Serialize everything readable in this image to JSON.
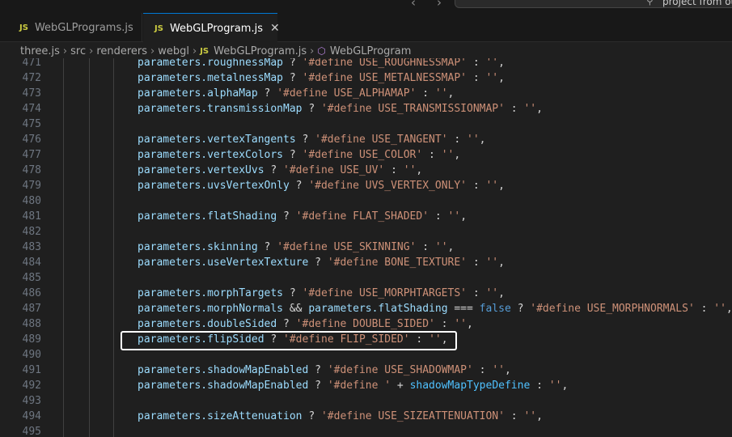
{
  "topbar": {
    "back_icon": "chevron-left-icon",
    "forward_icon": "chevron-right-icon",
    "command_center_text": "project from ouse"
  },
  "tabs": [
    {
      "badge": "JS",
      "label": "WebGLPrograms.js",
      "active": false
    },
    {
      "badge": "JS",
      "label": "WebGLProgram.js",
      "active": true
    }
  ],
  "breadcrumb": {
    "items": [
      "three.js",
      "src",
      "renderers",
      "webgl"
    ],
    "file_badge": "JS",
    "file": "WebGLProgram.js",
    "symbol": "WebGLProgram"
  },
  "colors": {
    "accent": "#0078d4",
    "property": "#9cdcfe",
    "string": "#ce9178",
    "keyword": "#569cd6",
    "variable": "#4fc1ff"
  },
  "code_lines": [
    {
      "num": "471",
      "tokens": [
        [
          "obj",
          "parameters.roughnessMap"
        ],
        [
          "op",
          " ? "
        ],
        [
          "str",
          "'#define USE_ROUGHNESSMAP'"
        ],
        [
          "op",
          " : "
        ],
        [
          "str",
          "''"
        ],
        [
          "op",
          ","
        ]
      ]
    },
    {
      "num": "472",
      "tokens": [
        [
          "obj",
          "parameters.metalnessMap"
        ],
        [
          "op",
          " ? "
        ],
        [
          "str",
          "'#define USE_METALNESSMAP'"
        ],
        [
          "op",
          " : "
        ],
        [
          "str",
          "''"
        ],
        [
          "op",
          ","
        ]
      ]
    },
    {
      "num": "473",
      "tokens": [
        [
          "obj",
          "parameters.alphaMap"
        ],
        [
          "op",
          " ? "
        ],
        [
          "str",
          "'#define USE_ALPHAMAP'"
        ],
        [
          "op",
          " : "
        ],
        [
          "str",
          "''"
        ],
        [
          "op",
          ","
        ]
      ]
    },
    {
      "num": "474",
      "tokens": [
        [
          "obj",
          "parameters.transmissionMap"
        ],
        [
          "op",
          " ? "
        ],
        [
          "str",
          "'#define USE_TRANSMISSIONMAP'"
        ],
        [
          "op",
          " : "
        ],
        [
          "str",
          "''"
        ],
        [
          "op",
          ","
        ]
      ]
    },
    {
      "num": "475",
      "tokens": []
    },
    {
      "num": "476",
      "tokens": [
        [
          "obj",
          "parameters.vertexTangents"
        ],
        [
          "op",
          " ? "
        ],
        [
          "str",
          "'#define USE_TANGENT'"
        ],
        [
          "op",
          " : "
        ],
        [
          "str",
          "''"
        ],
        [
          "op",
          ","
        ]
      ]
    },
    {
      "num": "477",
      "tokens": [
        [
          "obj",
          "parameters.vertexColors"
        ],
        [
          "op",
          " ? "
        ],
        [
          "str",
          "'#define USE_COLOR'"
        ],
        [
          "op",
          " : "
        ],
        [
          "str",
          "''"
        ],
        [
          "op",
          ","
        ]
      ]
    },
    {
      "num": "478",
      "tokens": [
        [
          "obj",
          "parameters.vertexUvs"
        ],
        [
          "op",
          " ? "
        ],
        [
          "str",
          "'#define USE_UV'"
        ],
        [
          "op",
          " : "
        ],
        [
          "str",
          "''"
        ],
        [
          "op",
          ","
        ]
      ]
    },
    {
      "num": "479",
      "tokens": [
        [
          "obj",
          "parameters.uvsVertexOnly"
        ],
        [
          "op",
          " ? "
        ],
        [
          "str",
          "'#define UVS_VERTEX_ONLY'"
        ],
        [
          "op",
          " : "
        ],
        [
          "str",
          "''"
        ],
        [
          "op",
          ","
        ]
      ]
    },
    {
      "num": "480",
      "tokens": []
    },
    {
      "num": "481",
      "tokens": [
        [
          "obj",
          "parameters.flatShading"
        ],
        [
          "op",
          " ? "
        ],
        [
          "str",
          "'#define FLAT_SHADED'"
        ],
        [
          "op",
          " : "
        ],
        [
          "str",
          "''"
        ],
        [
          "op",
          ","
        ]
      ]
    },
    {
      "num": "482",
      "tokens": []
    },
    {
      "num": "483",
      "tokens": [
        [
          "obj",
          "parameters.skinning"
        ],
        [
          "op",
          " ? "
        ],
        [
          "str",
          "'#define USE_SKINNING'"
        ],
        [
          "op",
          " : "
        ],
        [
          "str",
          "''"
        ],
        [
          "op",
          ","
        ]
      ]
    },
    {
      "num": "484",
      "tokens": [
        [
          "obj",
          "parameters.useVertexTexture"
        ],
        [
          "op",
          " ? "
        ],
        [
          "str",
          "'#define BONE_TEXTURE'"
        ],
        [
          "op",
          " : "
        ],
        [
          "str",
          "''"
        ],
        [
          "op",
          ","
        ]
      ]
    },
    {
      "num": "485",
      "tokens": []
    },
    {
      "num": "486",
      "tokens": [
        [
          "obj",
          "parameters.morphTargets"
        ],
        [
          "op",
          " ? "
        ],
        [
          "str",
          "'#define USE_MORPHTARGETS'"
        ],
        [
          "op",
          " : "
        ],
        [
          "str",
          "''"
        ],
        [
          "op",
          ","
        ]
      ]
    },
    {
      "num": "487",
      "tokens": [
        [
          "obj",
          "parameters.morphNormals"
        ],
        [
          "op",
          " && "
        ],
        [
          "obj",
          "parameters.flatShading"
        ],
        [
          "op",
          " === "
        ],
        [
          "kw",
          "false"
        ],
        [
          "op",
          " ? "
        ],
        [
          "str",
          "'#define USE_MORPHNORMALS'"
        ],
        [
          "op",
          " : "
        ],
        [
          "str",
          "''"
        ],
        [
          "op",
          ","
        ]
      ]
    },
    {
      "num": "488",
      "tokens": [
        [
          "obj",
          "parameters.doubleSided"
        ],
        [
          "op",
          " ? "
        ],
        [
          "str",
          "'#define DOUBLE_SIDED'"
        ],
        [
          "op",
          " : "
        ],
        [
          "str",
          "''"
        ],
        [
          "op",
          ","
        ]
      ]
    },
    {
      "num": "489",
      "tokens": [
        [
          "obj",
          "parameters.flipSided"
        ],
        [
          "op",
          " ? "
        ],
        [
          "str",
          "'#define FLIP_SIDED'"
        ],
        [
          "op",
          " : "
        ],
        [
          "str",
          "''"
        ],
        [
          "op",
          ","
        ]
      ]
    },
    {
      "num": "490",
      "tokens": []
    },
    {
      "num": "491",
      "tokens": [
        [
          "obj",
          "parameters.shadowMapEnabled"
        ],
        [
          "op",
          " ? "
        ],
        [
          "str",
          "'#define USE_SHADOWMAP'"
        ],
        [
          "op",
          " : "
        ],
        [
          "str",
          "''"
        ],
        [
          "op",
          ","
        ]
      ]
    },
    {
      "num": "492",
      "tokens": [
        [
          "obj",
          "parameters.shadowMapEnabled"
        ],
        [
          "op",
          " ? "
        ],
        [
          "str",
          "'#define '"
        ],
        [
          "op",
          " + "
        ],
        [
          "var",
          "shadowMapTypeDefine"
        ],
        [
          "op",
          " : "
        ],
        [
          "str",
          "''"
        ],
        [
          "op",
          ","
        ]
      ]
    },
    {
      "num": "493",
      "tokens": []
    },
    {
      "num": "494",
      "tokens": [
        [
          "obj",
          "parameters.sizeAttenuation"
        ],
        [
          "op",
          " ? "
        ],
        [
          "str",
          "'#define USE_SIZEATTENUATION'"
        ],
        [
          "op",
          " : "
        ],
        [
          "str",
          "''"
        ],
        [
          "op",
          ","
        ]
      ]
    },
    {
      "num": "495",
      "tokens": []
    }
  ]
}
